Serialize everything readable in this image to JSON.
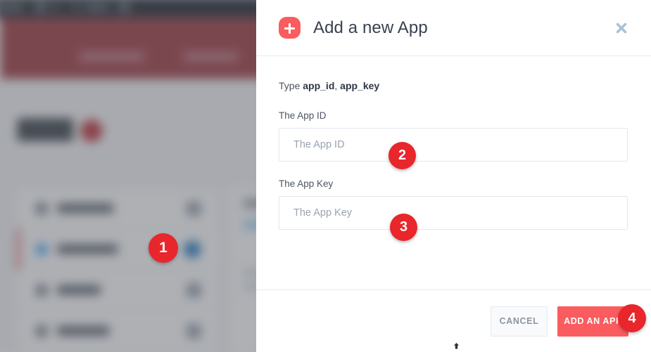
{
  "background": {
    "navbar": {
      "brand": "Blurred App",
      "items": [
        "nav-item",
        "nav-item",
        "nav-item"
      ]
    },
    "hero": {
      "tabs": [
        "tab-one",
        "tab-two"
      ]
    },
    "page_title": "Apps",
    "page_title_badge": "",
    "app_rows": [
      {
        "name": "Facebook",
        "toggle": "off"
      },
      {
        "name": "Instagram",
        "toggle": "on"
      },
      {
        "name": "Twitter",
        "toggle": "off"
      },
      {
        "name": "Linkedin",
        "toggle": "off"
      }
    ]
  },
  "modal": {
    "icon": "plus-icon",
    "title": "Add a new App",
    "close_label": "×",
    "hint": {
      "prefix": "Type ",
      "field_one": "app_id",
      "separator": ", ",
      "field_two": "app_key"
    },
    "fields": [
      {
        "label": "The App ID",
        "placeholder": "The App ID",
        "value": ""
      },
      {
        "label": "The App Key",
        "placeholder": "The App Key",
        "value": ""
      }
    ],
    "footer": {
      "cancel_label": "CANCEL",
      "submit_label": "ADD AN APP"
    }
  },
  "steps": [
    {
      "number": "1"
    },
    {
      "number": "2"
    },
    {
      "number": "3"
    },
    {
      "number": "4"
    }
  ],
  "colors": {
    "accent_coral": "#fa5c5f",
    "badge_red": "#e8262b",
    "title_text": "#3a4250",
    "label_text": "#4c5562",
    "placeholder": "#9aa3ae",
    "input_border": "#e2e8ee",
    "divider": "#e7ecf1",
    "cancel_text": "#8b95a3",
    "navbar_dark": "#2b3038",
    "hero_red": "#a34148",
    "toggle_blue": "#2b7fc4",
    "overlay": "rgba(75,80,88,0.45)"
  }
}
